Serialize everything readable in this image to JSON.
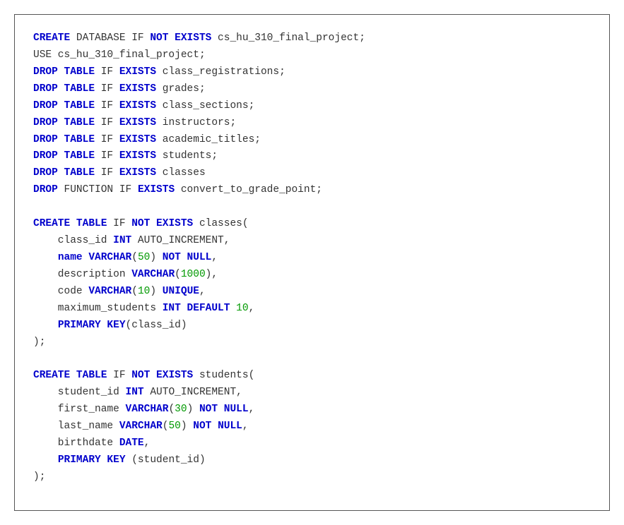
{
  "code": {
    "lines": [
      [
        [
          "kw",
          "CREATE"
        ],
        [
          "txt",
          " DATABASE IF "
        ],
        [
          "kw",
          "NOT EXISTS"
        ],
        [
          "txt",
          " cs_hu_310_final_project;"
        ]
      ],
      [
        [
          "txt",
          "USE cs_hu_310_final_project;"
        ]
      ],
      [
        [
          "kw",
          "DROP TABLE"
        ],
        [
          "txt",
          " IF "
        ],
        [
          "kw",
          "EXISTS"
        ],
        [
          "txt",
          " class_registrations;"
        ]
      ],
      [
        [
          "kw",
          "DROP TABLE"
        ],
        [
          "txt",
          " IF "
        ],
        [
          "kw",
          "EXISTS"
        ],
        [
          "txt",
          " grades;"
        ]
      ],
      [
        [
          "kw",
          "DROP TABLE"
        ],
        [
          "txt",
          " IF "
        ],
        [
          "kw",
          "EXISTS"
        ],
        [
          "txt",
          " class_sections;"
        ]
      ],
      [
        [
          "kw",
          "DROP TABLE"
        ],
        [
          "txt",
          " IF "
        ],
        [
          "kw",
          "EXISTS"
        ],
        [
          "txt",
          " instructors;"
        ]
      ],
      [
        [
          "kw",
          "DROP TABLE"
        ],
        [
          "txt",
          " IF "
        ],
        [
          "kw",
          "EXISTS"
        ],
        [
          "txt",
          " academic_titles;"
        ]
      ],
      [
        [
          "kw",
          "DROP TABLE"
        ],
        [
          "txt",
          " IF "
        ],
        [
          "kw",
          "EXISTS"
        ],
        [
          "txt",
          " students;"
        ]
      ],
      [
        [
          "kw",
          "DROP TABLE"
        ],
        [
          "txt",
          " IF "
        ],
        [
          "kw",
          "EXISTS"
        ],
        [
          "txt",
          " classes"
        ]
      ],
      [
        [
          "kw",
          "DROP"
        ],
        [
          "txt",
          " FUNCTION IF "
        ],
        [
          "kw",
          "EXISTS"
        ],
        [
          "txt",
          " convert_to_grade_point;"
        ]
      ],
      [
        [
          "txt",
          ""
        ]
      ],
      [
        [
          "kw",
          "CREATE TABLE"
        ],
        [
          "txt",
          " IF "
        ],
        [
          "kw",
          "NOT EXISTS"
        ],
        [
          "txt",
          " classes("
        ]
      ],
      [
        [
          "txt",
          "    class_id "
        ],
        [
          "kw",
          "INT"
        ],
        [
          "txt",
          " AUTO_INCREMENT,"
        ]
      ],
      [
        [
          "txt",
          "    "
        ],
        [
          "kw",
          "name VARCHAR"
        ],
        [
          "txt",
          "("
        ],
        [
          "num",
          "50"
        ],
        [
          "txt",
          ") "
        ],
        [
          "kw",
          "NOT NULL"
        ],
        [
          "txt",
          ","
        ]
      ],
      [
        [
          "txt",
          "    description "
        ],
        [
          "kw",
          "VARCHAR"
        ],
        [
          "txt",
          "("
        ],
        [
          "num",
          "1000"
        ],
        [
          "txt",
          "),"
        ]
      ],
      [
        [
          "txt",
          "    code "
        ],
        [
          "kw",
          "VARCHAR"
        ],
        [
          "txt",
          "("
        ],
        [
          "num",
          "10"
        ],
        [
          "txt",
          ") "
        ],
        [
          "kw",
          "UNIQUE"
        ],
        [
          "txt",
          ","
        ]
      ],
      [
        [
          "txt",
          "    maximum_students "
        ],
        [
          "kw",
          "INT DEFAULT "
        ],
        [
          "num",
          "10"
        ],
        [
          "txt",
          ","
        ]
      ],
      [
        [
          "txt",
          "    "
        ],
        [
          "kw",
          "PRIMARY KEY"
        ],
        [
          "txt",
          "(class_id)"
        ]
      ],
      [
        [
          "txt",
          ");"
        ]
      ],
      [
        [
          "txt",
          ""
        ]
      ],
      [
        [
          "kw",
          "CREATE TABLE"
        ],
        [
          "txt",
          " IF "
        ],
        [
          "kw",
          "NOT EXISTS"
        ],
        [
          "txt",
          " students("
        ]
      ],
      [
        [
          "txt",
          "    student_id "
        ],
        [
          "kw",
          "INT"
        ],
        [
          "txt",
          " AUTO_INCREMENT,"
        ]
      ],
      [
        [
          "txt",
          "    first_name "
        ],
        [
          "kw",
          "VARCHAR"
        ],
        [
          "txt",
          "("
        ],
        [
          "num",
          "30"
        ],
        [
          "txt",
          ") "
        ],
        [
          "kw",
          "NOT NULL"
        ],
        [
          "txt",
          ","
        ]
      ],
      [
        [
          "txt",
          "    last_name "
        ],
        [
          "kw",
          "VARCHAR"
        ],
        [
          "txt",
          "("
        ],
        [
          "num",
          "50"
        ],
        [
          "txt",
          ") "
        ],
        [
          "kw",
          "NOT NULL"
        ],
        [
          "txt",
          ","
        ]
      ],
      [
        [
          "txt",
          "    birthdate "
        ],
        [
          "kw",
          "DATE"
        ],
        [
          "txt",
          ","
        ]
      ],
      [
        [
          "txt",
          "    "
        ],
        [
          "kw",
          "PRIMARY KEY"
        ],
        [
          "txt",
          " (student_id)"
        ]
      ],
      [
        [
          "txt",
          ");"
        ]
      ]
    ]
  }
}
